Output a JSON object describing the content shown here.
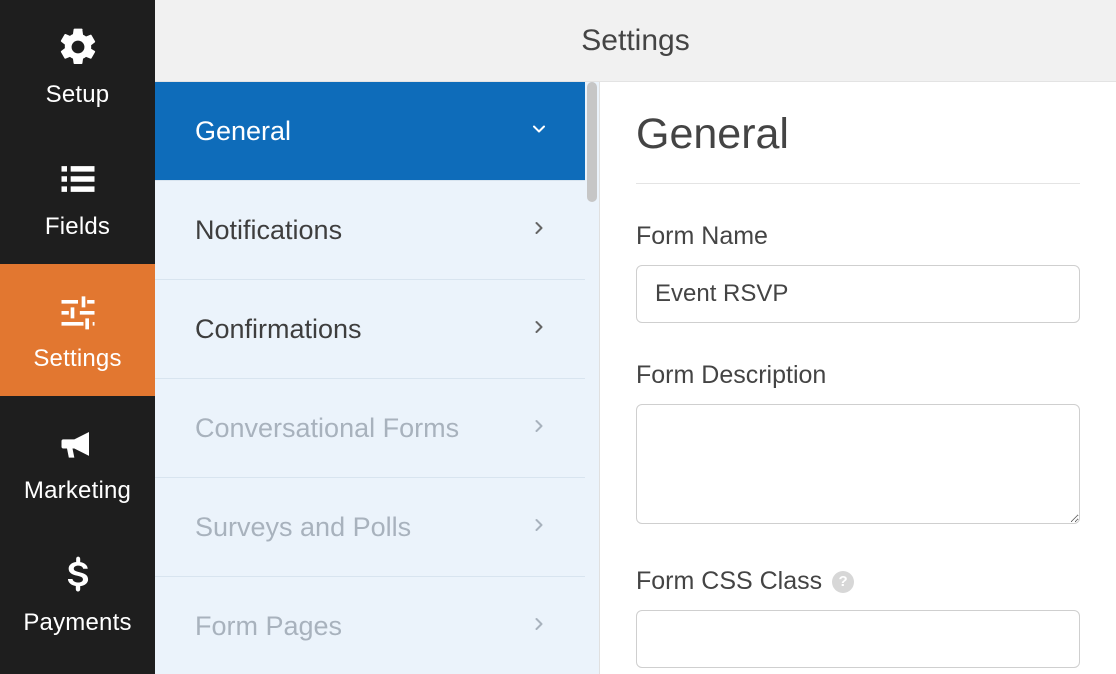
{
  "header": {
    "title": "Settings"
  },
  "sidenav": {
    "items": [
      {
        "label": "Setup"
      },
      {
        "label": "Fields"
      },
      {
        "label": "Settings"
      },
      {
        "label": "Marketing"
      },
      {
        "label": "Payments"
      }
    ]
  },
  "panel": {
    "items": [
      {
        "label": "General"
      },
      {
        "label": "Notifications"
      },
      {
        "label": "Confirmations"
      },
      {
        "label": "Conversational Forms"
      },
      {
        "label": "Surveys and Polls"
      },
      {
        "label": "Form Pages"
      }
    ]
  },
  "detail": {
    "heading": "General",
    "form_name_label": "Form Name",
    "form_name_value": "Event RSVP",
    "form_description_label": "Form Description",
    "form_description_value": "",
    "form_css_label": "Form CSS Class",
    "form_css_value": ""
  }
}
